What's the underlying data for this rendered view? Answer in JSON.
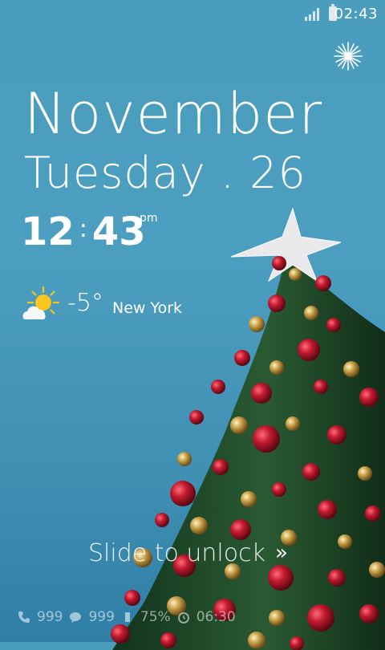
{
  "status_bar": {
    "time": "02:43",
    "icons": [
      "signal-icon",
      "battery-icon"
    ]
  },
  "lockscreen": {
    "month": "November",
    "day_date": "Tuesday . 26",
    "clock": {
      "hours": "12",
      "separator": ":",
      "minutes": "43",
      "ampm": "pm"
    },
    "weather": {
      "icon": "sun-cloud-icon",
      "temperature": "-5°",
      "city": "New York"
    },
    "unlock": {
      "label": "Slide to unlock",
      "arrow": "»"
    },
    "notifications": {
      "calls": "999",
      "messages": "999",
      "battery": "75%",
      "alarm": "06:30"
    }
  },
  "colors": {
    "sky": "#4a9dbd",
    "tree_green": "#1f4a2a",
    "ornament_red": "#b3192b",
    "ornament_gold": "#c9a24a"
  }
}
